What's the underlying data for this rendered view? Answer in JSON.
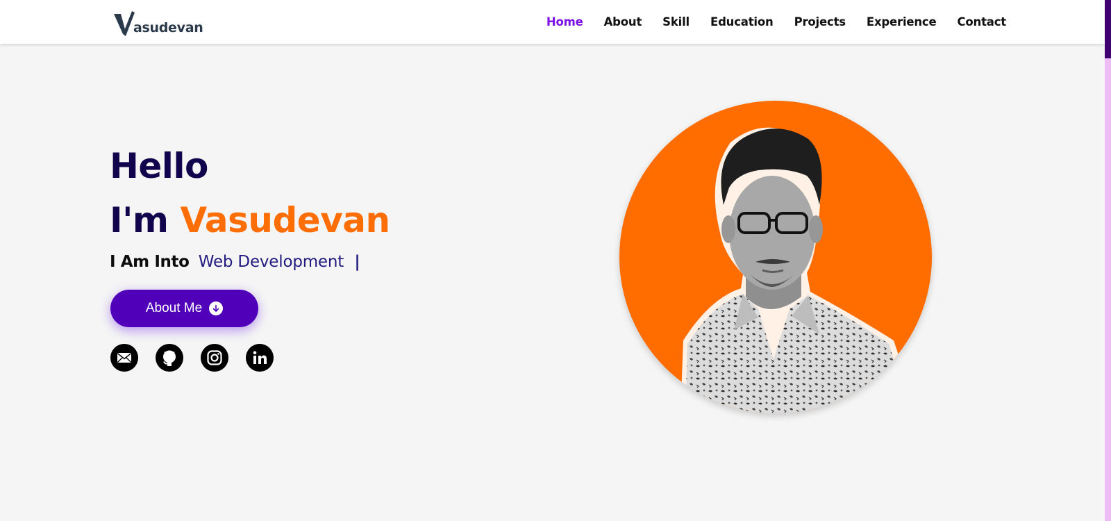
{
  "header": {
    "logo_text": "asudevan",
    "nav": [
      {
        "label": "Home",
        "active": true
      },
      {
        "label": "About"
      },
      {
        "label": "Skill"
      },
      {
        "label": "Education"
      },
      {
        "label": "Projects"
      },
      {
        "label": "Experience"
      },
      {
        "label": "Contact"
      }
    ]
  },
  "hero": {
    "greeting": "Hello",
    "intro_prefix": "I'm",
    "name": "Vasudevan",
    "into_prefix": "I Am Into",
    "typed_text": "Web Development",
    "cursor": "|",
    "button_label": "About Me"
  },
  "socials": [
    {
      "icon": "mail-icon"
    },
    {
      "icon": "github-icon"
    },
    {
      "icon": "instagram-icon"
    },
    {
      "icon": "linkedin-icon"
    }
  ],
  "colors": {
    "accent_purple": "#5000b8",
    "nav_active": "#7d12e8",
    "heading_navy": "#12034d",
    "name_orange": "#ff6d05",
    "typed_blue": "#231c80",
    "portrait_bg": "#ff6d00",
    "scroll_track": "#eebcf5",
    "scroll_thumb": "#3f0072"
  }
}
